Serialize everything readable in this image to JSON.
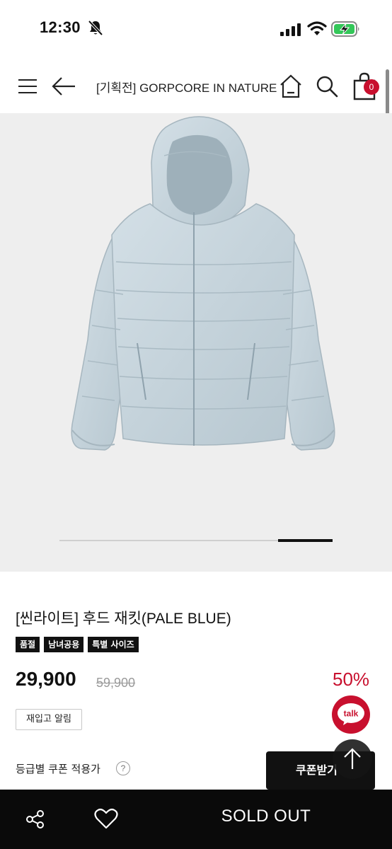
{
  "status_bar": {
    "time": "12:30",
    "icons": [
      "bell-slash-icon",
      "signal-icon",
      "wifi-icon",
      "battery-charging-icon"
    ]
  },
  "nav": {
    "title": "[기획전] GORPCORE IN NATURE",
    "cart_count": "0",
    "icons": [
      "menu-icon",
      "back-arrow-icon",
      "home-icon",
      "search-icon",
      "shopping-bag-icon"
    ]
  },
  "gallery": {
    "image": "pale-blue-hooded-puffer-jacket",
    "position": 5,
    "total": 5
  },
  "product": {
    "name": "[씬라이트] 후드 재킷(PALE BLUE)",
    "tags": [
      "품절",
      "남녀공용",
      "특별 사이즈"
    ],
    "price": "29,900",
    "original_price": "59,900",
    "discount": "50%",
    "restock_label": "재입고 알림",
    "talk_label": "talk",
    "coupon_note": "등급별 쿠폰 적용가",
    "help_symbol": "?",
    "coupon_button_label": "쿠폰받기"
  },
  "bottom_bar": {
    "sold_out_label": "SOLD OUT",
    "icons": [
      "share-icon",
      "heart-icon"
    ]
  },
  "colors": {
    "accent_red": "#c8102e",
    "bottom_bar_bg": "#0a0a0a",
    "image_bg": "#eeeeee",
    "jacket_color": "#c4d3db"
  }
}
